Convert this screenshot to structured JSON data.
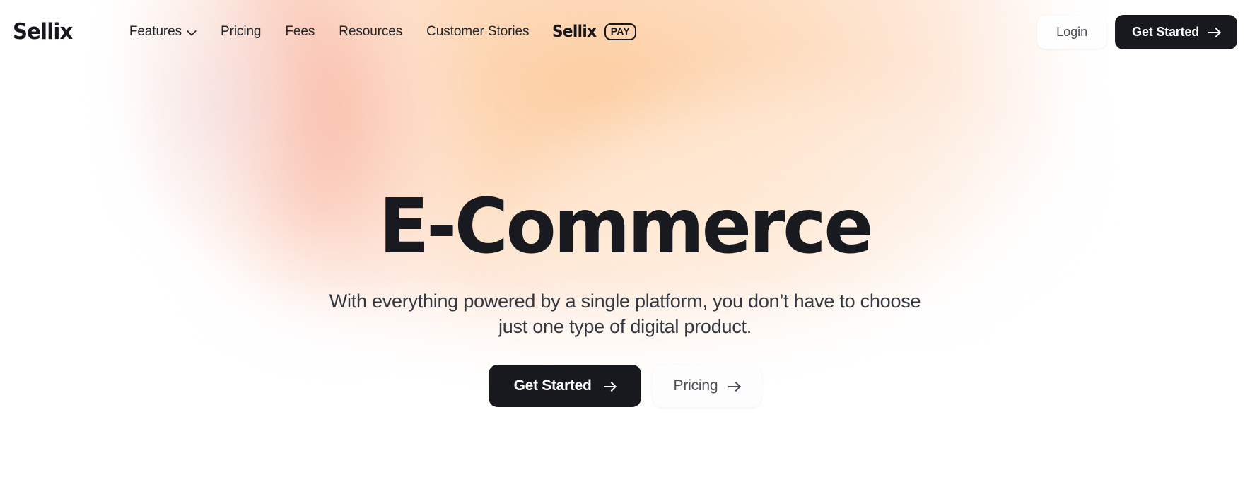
{
  "brand": {
    "name": "Sellix"
  },
  "nav": {
    "items": [
      {
        "label": "Features",
        "has_dropdown": true,
        "icon": "chevron-down-icon"
      },
      {
        "label": "Pricing",
        "has_dropdown": false
      },
      {
        "label": "Fees",
        "has_dropdown": false
      },
      {
        "label": "Resources",
        "has_dropdown": false
      },
      {
        "label": "Customer Stories",
        "has_dropdown": false
      }
    ],
    "pay_logo": {
      "word": "Sellix",
      "badge": "PAY"
    },
    "login_label": "Login",
    "get_started_label": "Get Started",
    "get_started_icon": "arrow-right-icon"
  },
  "hero": {
    "title": "E-Commerce",
    "subtitle": "With everything powered by a single platform, you don’t have to choose just one type of digital product.",
    "primary_cta": {
      "label": "Get Started",
      "icon": "arrow-right-icon"
    },
    "secondary_cta": {
      "label": "Pricing",
      "icon": "arrow-right-icon"
    }
  },
  "colors": {
    "page_background": "#ffffff",
    "ink": "#17191e",
    "muted_text": "#4a4f58",
    "body_text": "#33373f",
    "gradient_peach": "#fbc894",
    "gradient_salmon": "#f9baa7",
    "gradient_cream": "#fdeadb"
  }
}
